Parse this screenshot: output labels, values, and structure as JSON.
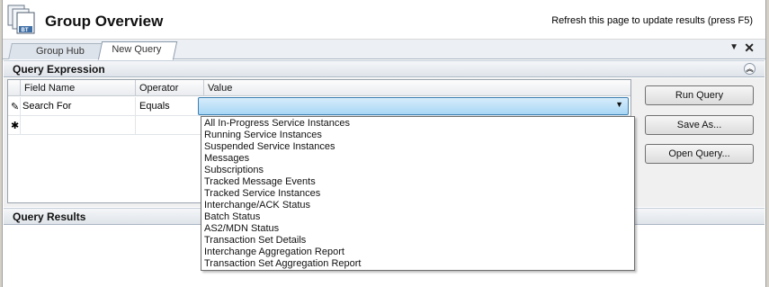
{
  "header": {
    "title": "Group Overview",
    "refresh_hint": "Refresh this page to update results (press F5)",
    "icon_badge": "BT"
  },
  "tabs": [
    {
      "label": "Group Hub",
      "active": false
    },
    {
      "label": "New Query",
      "active": true
    }
  ],
  "window_controls": {
    "pin_glyph": "▼",
    "close_glyph": "✕"
  },
  "query_expression": {
    "title": "Query Expression",
    "collapse_glyph": "︽",
    "columns": [
      "Field Name",
      "Operator",
      "Value"
    ],
    "rows": [
      {
        "marker": "✎",
        "field": "Search For",
        "operator": "Equals",
        "value": ""
      },
      {
        "marker": "✱",
        "field": "",
        "operator": "",
        "value": ""
      }
    ],
    "combo_arrow": "▼",
    "dropdown_options": [
      "All In-Progress Service Instances",
      "Running Service Instances",
      "Suspended Service Instances",
      "Messages",
      "Subscriptions",
      "Tracked Message Events",
      "Tracked Service Instances",
      "Interchange/ACK Status",
      "Batch Status",
      "AS2/MDN Status",
      "Transaction Set Details",
      "Interchange Aggregation Report",
      "Transaction Set Aggregation Report"
    ]
  },
  "buttons": {
    "run": "Run Query",
    "save": "Save As...",
    "open": "Open Query..."
  },
  "query_results": {
    "title": "Query Results"
  },
  "colors": {
    "combo_highlight": "#a9d7f5",
    "tab_border": "#a8b4c2"
  }
}
